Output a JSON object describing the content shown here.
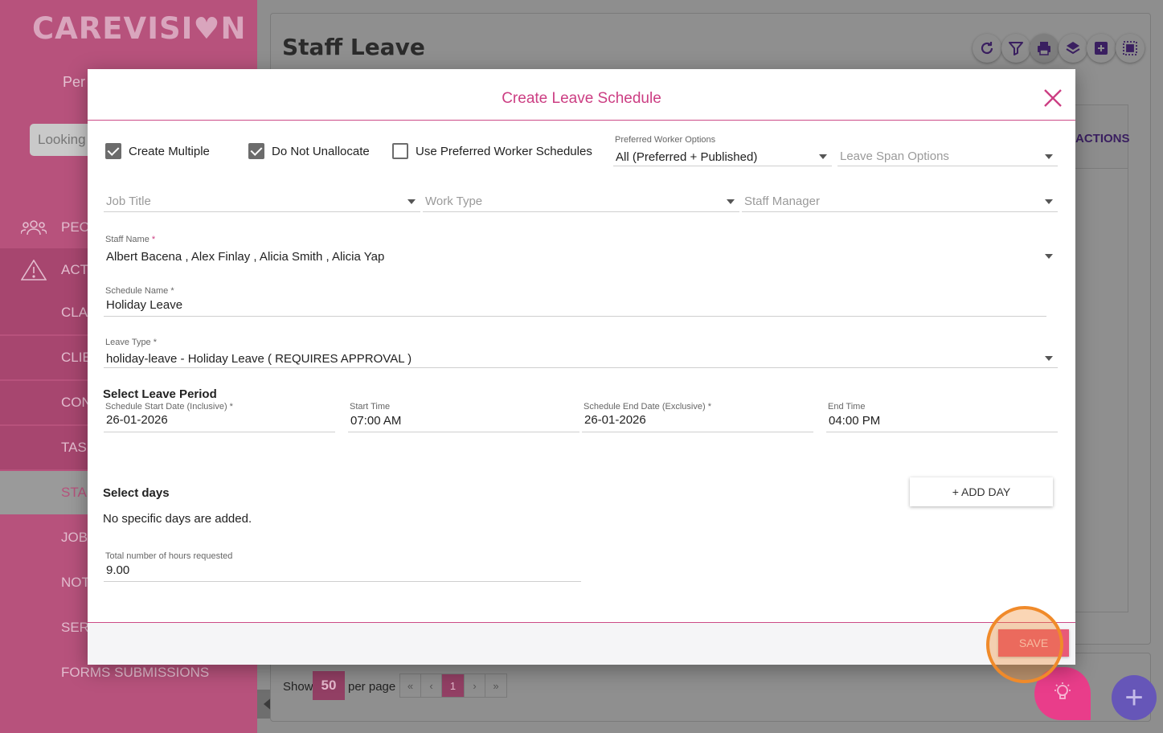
{
  "sidebar": {
    "logo": "CAREVISI♥N",
    "subtitle": "Per",
    "search_placeholder": "Looking",
    "items": [
      {
        "label": "PEO",
        "icon": "people-icon"
      },
      {
        "label": "ACTI",
        "icon": "warning-icon"
      },
      {
        "label": "CLAI"
      },
      {
        "label": "CLIE"
      },
      {
        "label": "CON"
      },
      {
        "label": "TASK"
      },
      {
        "label": "STAF"
      },
      {
        "label": "JOB"
      },
      {
        "label": "NOT"
      },
      {
        "label": "SERV"
      },
      {
        "label": "FORMS SUBMISSIONS"
      }
    ]
  },
  "page": {
    "title": "Staff Leave",
    "actions_header": "ACTIONS",
    "toolbar_icons": [
      "refresh-icon",
      "filter-icon",
      "print-icon",
      "layers-icon",
      "add-box-icon",
      "select-all-icon"
    ]
  },
  "pager": {
    "show_label": "Show",
    "page_size": "50",
    "per_page_label": "per page",
    "first": "«",
    "prev": "‹",
    "current": "1",
    "next": "›",
    "last": "»"
  },
  "modal": {
    "title": "Create Leave Schedule",
    "checkboxes": {
      "create_multiple": {
        "label": "Create Multiple",
        "checked": true
      },
      "do_not_unallocate": {
        "label": "Do Not Unallocate",
        "checked": true
      },
      "use_preferred": {
        "label": "Use Preferred Worker Schedules",
        "checked": false
      }
    },
    "preferred_worker_options": {
      "label": "Preferred Worker Options",
      "value": "All (Preferred + Published)"
    },
    "leave_span_options": {
      "placeholder": "Leave Span Options"
    },
    "job_title": {
      "placeholder": "Job Title"
    },
    "work_type": {
      "placeholder": "Work Type"
    },
    "staff_manager": {
      "placeholder": "Staff Manager"
    },
    "staff_name": {
      "label": "Staff Name",
      "required_mark": "*",
      "value": "Albert Bacena , Alex Finlay , Alicia Smith , Alicia Yap"
    },
    "schedule_name": {
      "label": "Schedule Name *",
      "value": "Holiday Leave"
    },
    "leave_type": {
      "label": "Leave Type *",
      "value": "holiday-leave - Holiday Leave ( REQUIRES APPROVAL )"
    },
    "leave_period_title": "Select Leave Period",
    "start_date": {
      "label": "Schedule Start Date (Inclusive) *",
      "value": "26-01-2026"
    },
    "start_time": {
      "label": "Start Time",
      "value": "07:00 AM"
    },
    "end_date": {
      "label": "Schedule End Date (Exclusive) *",
      "value": "26-01-2026"
    },
    "end_time": {
      "label": "End Time",
      "value": "04:00 PM"
    },
    "select_days_title": "Select days",
    "add_day_label": "+ ADD DAY",
    "no_days_text": "No specific days are added.",
    "total_hours": {
      "label": "Total number of hours requested",
      "value": "9.00"
    },
    "save_label": "SAVE"
  },
  "colors": {
    "accent": "#cc3e83",
    "save": "#e85a78",
    "highlight": "#f08a2a",
    "fab_purple": "#6656b8",
    "fab_pink": "#e93d8a"
  }
}
